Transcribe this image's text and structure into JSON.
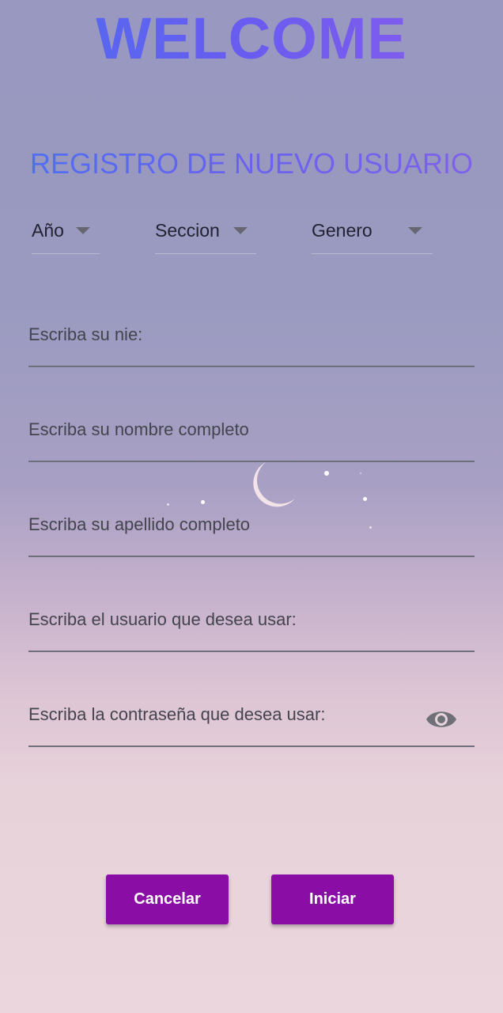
{
  "header": {
    "title": "WELCOME",
    "subtitle": "REGISTRO DE NUEVO USUARIO"
  },
  "dropdowns": [
    {
      "label": "Año"
    },
    {
      "label": "Seccion"
    },
    {
      "label": "Genero"
    }
  ],
  "form": {
    "nie_label": "Escriba su nie:",
    "name_label": "Escriba su nombre completo",
    "surname_label": "Escriba su apellido completo",
    "username_label": "Escriba el usuario que desea usar:",
    "password_label": "Escriba la contraseña que desea usar:",
    "password_toggle_icon": "eye-icon"
  },
  "buttons": {
    "cancel": "Cancelar",
    "start": "Iniciar"
  },
  "colors": {
    "accent": "#8a0ea6",
    "title_gradient_start": "#4e6cf0",
    "title_gradient_end": "#8a5cec"
  },
  "background_icon": "crescent-moon-with-stars"
}
